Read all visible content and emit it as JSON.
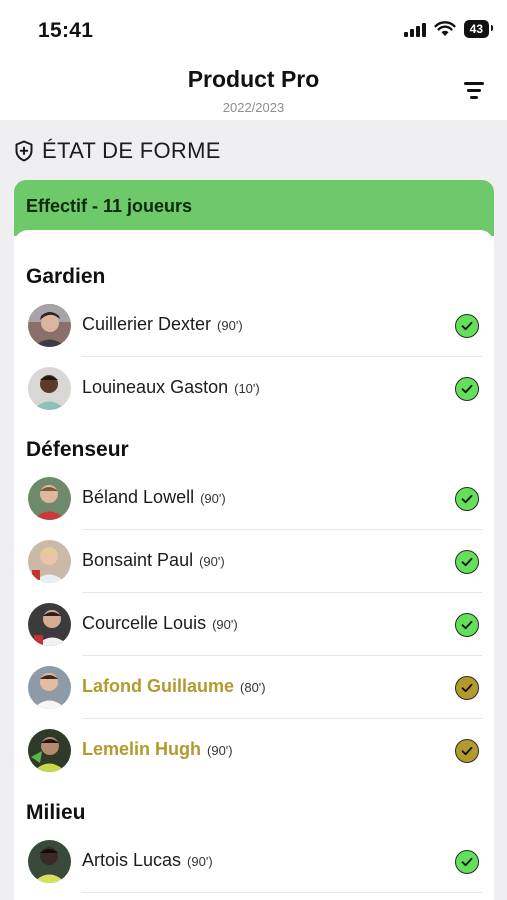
{
  "status": {
    "time": "15:41",
    "battery": "43"
  },
  "nav": {
    "title": "Product Pro",
    "subtitle": "2022/2023"
  },
  "section": {
    "label": "ÉTAT DE FORME",
    "icon": "shield-plus-icon"
  },
  "card": {
    "title": "Effectif - 11 joueurs",
    "header_color": "#6ec96b"
  },
  "colors": {
    "ok": "#62e05a",
    "warn": "#b39a2d"
  },
  "groups": [
    {
      "title": "Gardien",
      "players": [
        {
          "name": "Cuillerier Dexter",
          "minutes": "(90')",
          "status": "ok"
        },
        {
          "name": "Louineaux Gaston",
          "minutes": "(10')",
          "status": "ok"
        }
      ]
    },
    {
      "title": "Défenseur",
      "players": [
        {
          "name": "Béland Lowell",
          "minutes": "(90')",
          "status": "ok"
        },
        {
          "name": "Bonsaint Paul",
          "minutes": "(90')",
          "status": "ok"
        },
        {
          "name": "Courcelle Louis",
          "minutes": "(90')",
          "status": "ok"
        },
        {
          "name": "Lafond Guillaume",
          "minutes": "(80')",
          "status": "warn"
        },
        {
          "name": "Lemelin Hugh",
          "minutes": "(90')",
          "status": "warn"
        }
      ]
    },
    {
      "title": "Milieu",
      "players": [
        {
          "name": "Artois Lucas",
          "minutes": "(90')",
          "status": "ok"
        }
      ]
    }
  ]
}
